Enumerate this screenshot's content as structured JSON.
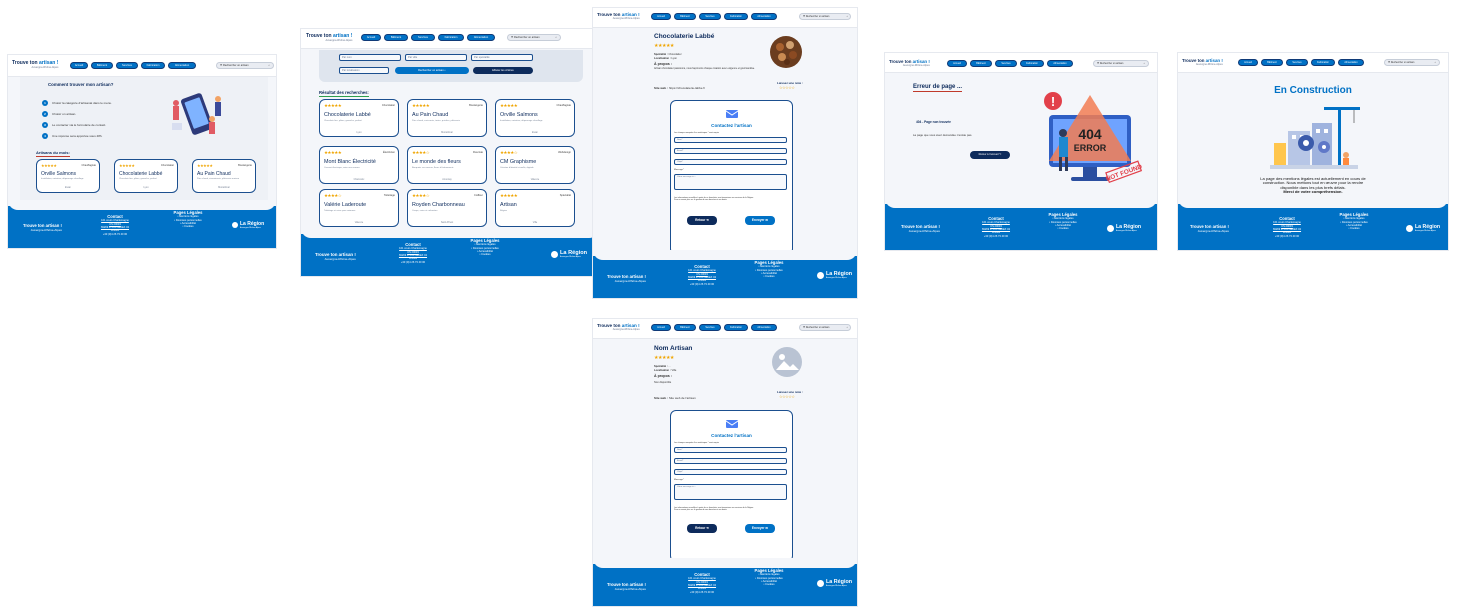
{
  "brand": {
    "name_a": "Trouve ton ",
    "name_b": "artisan",
    "mark": "!",
    "sub": "Auvergne-Rhône-Alpes"
  },
  "nav": [
    "Accueil",
    "Bâtiment",
    "Services",
    "Fabrication",
    "Alimentation"
  ],
  "search_placeholder": "Rechercher un artisan",
  "colors": {
    "primary": "#0071c5",
    "dark": "#0d2b5c",
    "star": "#f0a500",
    "accent": "#c03a2b"
  },
  "footer": {
    "contact_title": "Contact",
    "address": [
      "101 cours Charlemagne",
      "CS 20033",
      "69269 LYON CEDEX 02",
      "France"
    ],
    "phone": "+33 (0)4 26 73 40 00",
    "legal_title": "Pages Légales",
    "legal": [
      "Mentions légales",
      "Données personnelles",
      "Accessibilité",
      "Cookies"
    ],
    "region": "La Région",
    "region_sub": "Auvergne-Rhône-Alpes"
  },
  "home": {
    "title": "Comment trouver mon artisan?",
    "steps": [
      "Choisir la catégorie d'artisanat dans le menu.",
      "Choisir un artisan.",
      "Le contacter via le formulaire de contact.",
      "Une réponse sera apportée sous 48h."
    ],
    "month_title": "Artisans du mois:",
    "artisans": [
      {
        "stars": "★★★★★",
        "spec": "Chauffagiste",
        "name": "Orville Salmons",
        "desc": "Installation, entretien, dépannage chauffage",
        "city": "Evian"
      },
      {
        "stars": "★★★★★",
        "spec": "Chocolatier",
        "name": "Chocolaterie Labbé",
        "desc": "Chocolats fins, pâtes, ganache, praliné",
        "city": "Lyon"
      },
      {
        "stars": "★★★★★",
        "spec": "Boulangerie",
        "name": "Au Pain Chaud",
        "desc": "Pain chaud, viennoiserie, pâtisserie maison",
        "city": "Montélimar"
      }
    ]
  },
  "search": {
    "filters": [
      "Par nom",
      "Par ville",
      "Par spécialité",
      "Par localisation"
    ],
    "search_btn": "Rechercher un artisan",
    "reset_btn": "Effacer les critères",
    "results_title": "Résultat des recherches:",
    "results": [
      {
        "stars": "★★★★★",
        "spec": "Chocolatier",
        "name": "Chocolaterie Labbé",
        "desc": "Chocolats fins, pâtes, ganache, praliné",
        "city": "Lyon"
      },
      {
        "stars": "★★★★★",
        "spec": "Boulangerie",
        "name": "Au Pain Chaud",
        "desc": "Pain chaud, croissants, tartes, quiches, pâtisserie",
        "city": "Montélimar"
      },
      {
        "stars": "★★★★★",
        "spec": "Chauffagiste",
        "name": "Orville Salmons",
        "desc": "Installation, entretien, dépannage chauffage",
        "city": "Evian"
      },
      {
        "stars": "★★★★★",
        "spec": "Électricien",
        "name": "Mont Blanc Électricité",
        "desc": "Courant électrique, mise aux normes",
        "city": "Chamonix"
      },
      {
        "stars": "★★★★☆",
        "spec": "Fleuriste",
        "name": "Le monde des fleurs",
        "desc": "Bouquets sur mesure, fleurs d'évènements",
        "city": "Annonay"
      },
      {
        "stars": "★★★★☆",
        "spec": "Webdesign",
        "name": "CM Graphisme",
        "desc": "Création d'identité visuelle, digitale",
        "city": "Valence"
      },
      {
        "stars": "★★★★☆",
        "spec": "Toilettage",
        "name": "Valérie Laderoute",
        "desc": "Toilettage et soins pour animaux",
        "city": "Valence"
      },
      {
        "stars": "★★★★☆",
        "spec": "Coiffeur",
        "name": "Royden Charbonneau",
        "desc": "Coupe, soins et coloration",
        "city": "Saint-Priest"
      },
      {
        "stars": "★★★★★",
        "spec": "Spécialité",
        "name": "Artisan",
        "desc": "Région",
        "city": "Ville"
      }
    ]
  },
  "detail1": {
    "name": "Chocolaterie Labbé",
    "stars": "★★★★★",
    "spec_label": "Spécialité :",
    "spec": "Chocolatier",
    "loc_label": "Localisation :",
    "loc": "Lyon",
    "about_label": "À propos :",
    "about": "Artisan chocolatier passionné, nous façonnons chaque création avec exigence et gourmandise.",
    "site_label": "Site web :",
    "site": "https://chocolaterie-labbe.fr",
    "review_label": "Laissez une note :",
    "review_stars": "☆☆☆☆☆"
  },
  "detail2": {
    "name": "Nom Artisan",
    "stars": "★★★★★",
    "spec_label": "Spécialité :",
    "spec": "...",
    "loc_label": "Localisation :",
    "loc": "Ville",
    "about_label": "À propos :",
    "about": "Non disponible",
    "site_label": "Site web :",
    "site": "Site web de l'artisan",
    "review_label": "Laissez une note :",
    "review_stars": "☆☆☆☆☆"
  },
  "form": {
    "title": "Contactez l'artisan",
    "required": "Les champs marqués d'un astérisque * sont requis",
    "name": "Nom*",
    "email": "Email*",
    "subject": "Objet*",
    "message_label": "Message*",
    "message_ph": "Votre message ici...",
    "legal": "Les informations recueillies à partir de ce formulaire sont transmises aux services de la Région.",
    "legal2": "Pour en savoir plus sur la gestion de vos données et vos droits.",
    "back": "Retour ⟲",
    "send": "Envoyer ✉"
  },
  "error": {
    "title": "Erreur de page ...",
    "code": "404 - Page non trouvée",
    "msg": "La page que vous avez demandée n'existe pas.",
    "btn": "Retour à l'accueil",
    "art_code": "404",
    "art_word": "ERROR",
    "stamp": "NOT FOUND"
  },
  "construction": {
    "title": "En Construction",
    "line1": "La page des mentions légales est actuellement en cours de",
    "line2": "construction. Nous mettons tout en œuvre pour la rendre",
    "line3": "disponible dans les plus brefs délais.",
    "thanks": "Merci de votre compréhension."
  }
}
